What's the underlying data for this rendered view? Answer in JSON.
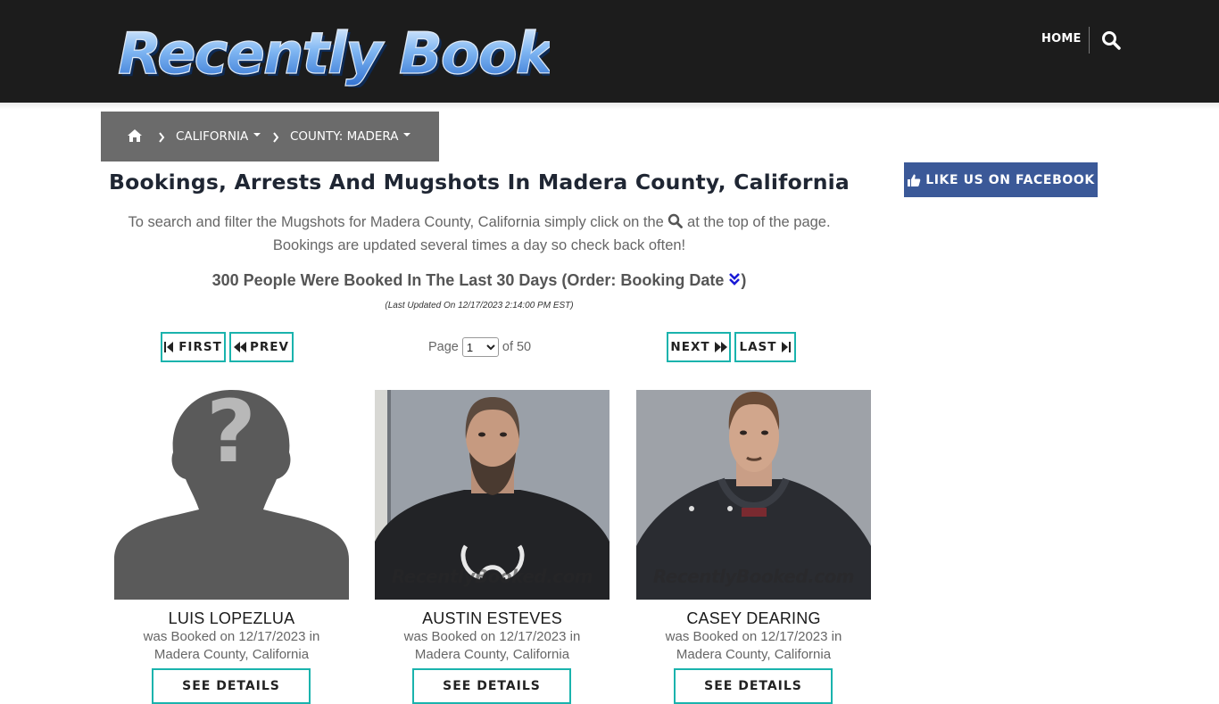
{
  "header": {
    "logo_text": "Recently Booked",
    "nav_home": "HOME",
    "search_icon": "search-icon"
  },
  "breadcrumb": {
    "home_icon": "home-icon",
    "state": "CALIFORNIA",
    "county": "COUNTY: MADERA"
  },
  "main": {
    "title": "Bookings, Arrests And Mugshots In Madera County, California",
    "intro_part1": "To search and filter the Mugshots for Madera County, California simply click on the",
    "intro_part2": "at the top of the page.",
    "intro_line2": "Bookings are updated several times a day so check back often!",
    "count_text": "300 People Were Booked In The Last 30 Days (Order: Booking Date",
    "count_close": ")",
    "updated": "(Last Updated On 12/17/2023 2:14:00 PM EST)"
  },
  "pagination": {
    "first": "FIRST",
    "prev": "PREV",
    "next": "NEXT",
    "last": "LAST",
    "page_label": "Page",
    "current_page": "1",
    "of_label": "of 50"
  },
  "sidebar": {
    "facebook_label": "LIKE US ON FACEBOOK"
  },
  "bookings": [
    {
      "name": "LUIS LOPEZLUA",
      "line1": "was Booked on 12/17/2023 in",
      "line2": "Madera County, California",
      "button": "SEE DETAILS",
      "photo": "placeholder-silhouette"
    },
    {
      "name": "AUSTIN ESTEVES",
      "line1": "was Booked on 12/17/2023 in",
      "line2": "Madera County, California",
      "button": "SEE DETAILS",
      "photo": "mugshot",
      "watermark": "RecentlyBooked.com"
    },
    {
      "name": "CASEY DEARING",
      "line1": "was Booked on 12/17/2023 in",
      "line2": "Madera County, California",
      "button": "SEE DETAILS",
      "photo": "mugshot",
      "watermark": "RecentlyBooked.com"
    }
  ],
  "colors": {
    "topbar": "#1c1c1c",
    "breadcrumb": "#6b6b6b",
    "accent_teal": "#1ab3ad",
    "facebook": "#3b5998",
    "logo_blue": "#5b9ee8"
  }
}
